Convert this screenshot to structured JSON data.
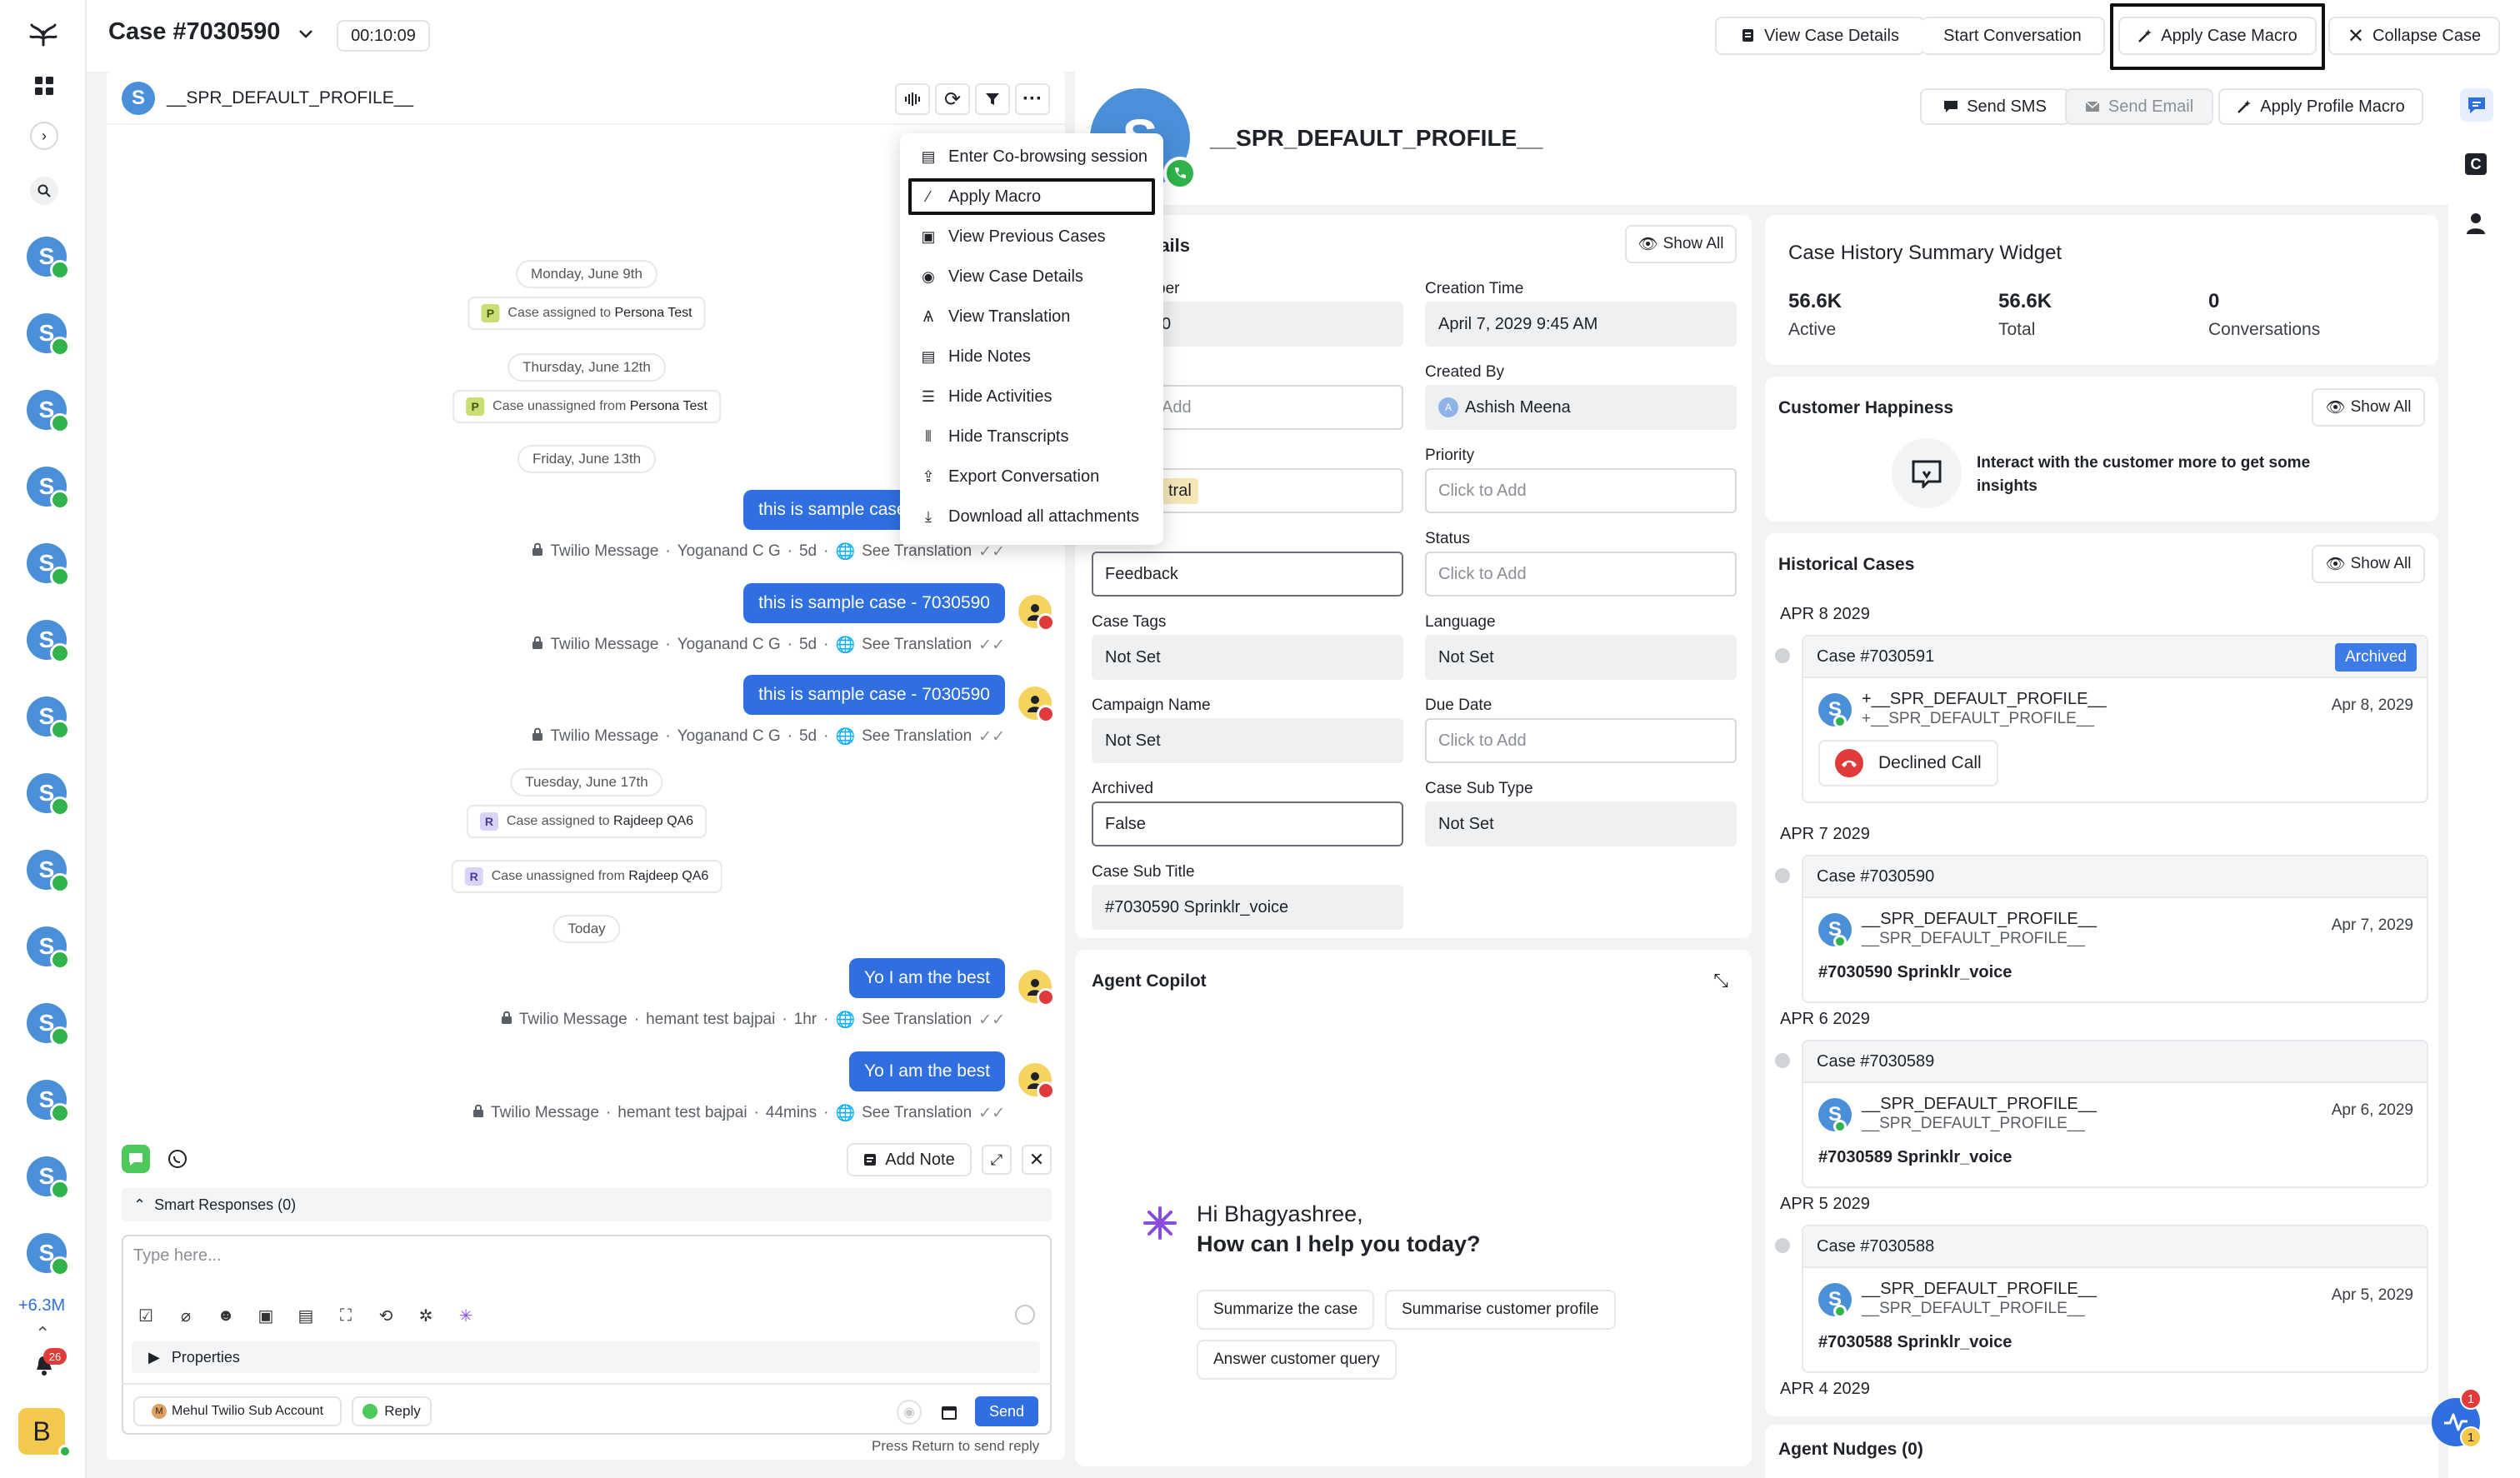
{
  "header": {
    "case_title": "Case #7030590",
    "timer": "00:10:09",
    "view_case_details": "View Case Details",
    "start_conversation": "Start Conversation",
    "apply_case_macro": "Apply Case Macro",
    "collapse_case": "Collapse Case"
  },
  "rail": {
    "count": "+6.3M",
    "notif_badge": "26",
    "user_initial": "B",
    "avatar_letter": "S"
  },
  "conversation": {
    "profile_initial": "S",
    "profile_name": "__SPR_DEFAULT_PROFILE__",
    "dates": [
      "Monday, June 9th",
      "Thursday, June 12th",
      "Friday, June 13th",
      "Tuesday, June 17th",
      "Today"
    ],
    "system": [
      {
        "badge": "P",
        "prefix": "Case assigned to",
        "name": "Persona Test"
      },
      {
        "badge": "P",
        "prefix": "Case unassigned from",
        "name": "Persona Test"
      },
      {
        "badge": "R",
        "prefix": "Case assigned to",
        "name": "Rajdeep QA6"
      },
      {
        "badge": "R",
        "prefix": "Case unassigned from",
        "name": "Rajdeep QA6"
      }
    ],
    "messages": [
      {
        "text": "this is sample case -  7030590",
        "channel": "Twilio Message",
        "agent": "Yoganand C G",
        "time": "5d",
        "translation": "See Translation"
      },
      {
        "text": "this is sample case -  7030590",
        "channel": "Twilio Message",
        "agent": "Yoganand C G",
        "time": "5d",
        "translation": "See Translation"
      },
      {
        "text": "this is sample case -  7030590",
        "channel": "Twilio Message",
        "agent": "Yoganand C G",
        "time": "5d",
        "translation": "See Translation"
      },
      {
        "text": "Yo I am the best",
        "channel": "Twilio Message",
        "agent": "hemant test bajpai",
        "time": "1hr",
        "translation": "See Translation"
      },
      {
        "text": "Yo I am the best",
        "channel": "Twilio Message",
        "agent": "hemant test bajpai",
        "time": "44mins",
        "translation": "See Translation"
      }
    ],
    "add_note": "Add Note",
    "smart_responses": "Smart Responses (0)",
    "composer_placeholder": "Type here...",
    "properties": "Properties",
    "account": "Mehul Twilio Sub Account",
    "reply": "Reply",
    "send": "Send",
    "hint": "Press Return to send reply"
  },
  "menu": {
    "items": [
      "Enter Co-browsing session",
      "Apply Macro",
      "View Previous Cases",
      "View Case Details",
      "View Translation",
      "Hide Notes",
      "Hide Activities",
      "Hide Transcripts",
      "Export Conversation",
      "Download all attachments"
    ]
  },
  "profile": {
    "avatar_letter": "S",
    "name": "__SPR_DEFAULT_PROFILE__",
    "send_sms": "Send SMS",
    "send_email": "Send Email",
    "apply_profile_macro": "Apply Profile Macro"
  },
  "details": {
    "title": "tails",
    "show_all": "Show All",
    "left": [
      {
        "label": "ber",
        "value": "0",
        "style": "grey"
      },
      {
        "label": "",
        "value": "Add",
        "style": "ph"
      },
      {
        "label": "",
        "value": "tral",
        "style": "w"
      },
      {
        "label": "",
        "value": "Feedback",
        "style": "dk"
      },
      {
        "label": "Case Tags",
        "value": "Not Set",
        "style": "grey"
      },
      {
        "label": "Campaign Name",
        "value": "Not Set",
        "style": "grey"
      },
      {
        "label": "Archived",
        "value": "False",
        "style": "dk"
      },
      {
        "label": "Case Sub Title",
        "value": "#7030590 Sprinklr_voice",
        "style": "grey"
      }
    ],
    "right": [
      {
        "label": "Creation Time",
        "value": "April 7, 2029 9:45 AM",
        "style": "grey"
      },
      {
        "label": "Created By",
        "value": "Ashish Meena",
        "style": "grey"
      },
      {
        "label": "Priority",
        "value": "Click to Add",
        "style": "ph"
      },
      {
        "label": "Status",
        "value": "Click to Add",
        "style": "ph"
      },
      {
        "label": "Language",
        "value": "Not Set",
        "style": "grey"
      },
      {
        "label": "Due Date",
        "value": "Click to Add",
        "style": "ph"
      },
      {
        "label": "Case Sub Type",
        "value": "Not Set",
        "style": "grey"
      }
    ]
  },
  "copilot": {
    "title": "Agent Copilot",
    "greeting": "Hi Bhagyashree,",
    "question": "How can I help you today?",
    "suggestions": [
      "Summarize the case",
      "Summarise customer profile",
      "Answer customer query"
    ]
  },
  "summary": {
    "title": "Case History Summary Widget",
    "stats": [
      {
        "value": "56.6K",
        "label": "Active"
      },
      {
        "value": "56.6K",
        "label": "Total"
      },
      {
        "value": "0",
        "label": "Conversations"
      }
    ]
  },
  "happiness": {
    "title": "Customer Happiness",
    "show_all": "Show All",
    "message": "Interact with the customer more to get some insights"
  },
  "historical": {
    "title": "Historical Cases",
    "show_all": "Show All",
    "groups": [
      {
        "date": "APR 8 2029",
        "case": "Case #7030591",
        "badge": "Archived",
        "profile": "+__SPR_DEFAULT_PROFILE__",
        "profile_sub": "+__SPR_DEFAULT_PROFILE__",
        "case_date": "Apr 8, 2029",
        "call": "Declined Call"
      },
      {
        "date": "APR 7 2029",
        "case": "Case #7030590",
        "profile": "__SPR_DEFAULT_PROFILE__",
        "profile_sub": "__SPR_DEFAULT_PROFILE__",
        "case_date": "Apr 7, 2029",
        "subtitle": "#7030590 Sprinklr_voice"
      },
      {
        "date": "APR 6 2029",
        "case": "Case #7030589",
        "profile": "__SPR_DEFAULT_PROFILE__",
        "profile_sub": "__SPR_DEFAULT_PROFILE__",
        "case_date": "Apr 6, 2029",
        "subtitle": "#7030589 Sprinklr_voice"
      },
      {
        "date": "APR 5 2029",
        "case": "Case #7030588",
        "profile": "__SPR_DEFAULT_PROFILE__",
        "profile_sub": "__SPR_DEFAULT_PROFILE__",
        "case_date": "Apr 5, 2029",
        "subtitle": "#7030588 Sprinklr_voice"
      }
    ],
    "next_date": "APR 4 2029",
    "initial": "S"
  },
  "nudges": {
    "title": "Agent Nudges (0)"
  },
  "floating": {
    "badge1": "1",
    "badge2": "1"
  },
  "colors": {
    "accent": "#2f6fe0",
    "online": "#2fb34a",
    "danger": "#e03a3a"
  }
}
